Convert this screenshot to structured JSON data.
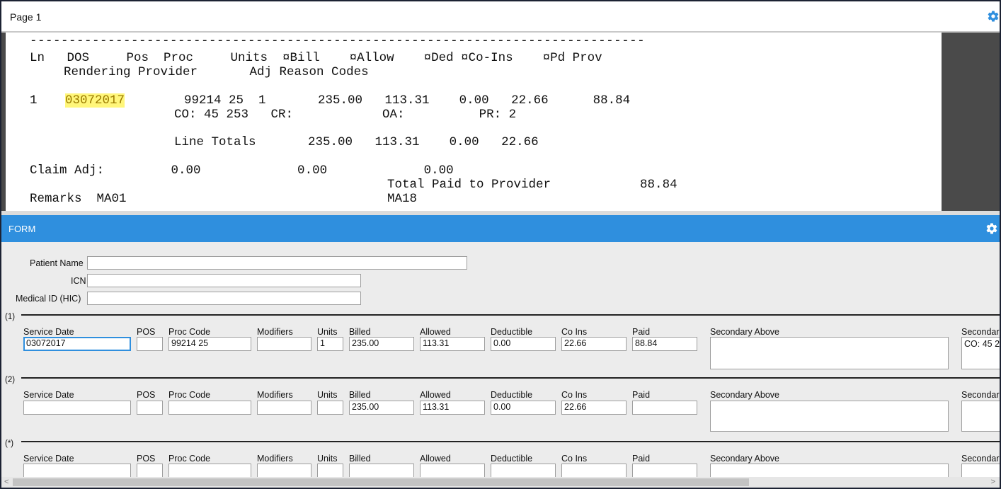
{
  "page_panel": {
    "title": "Page 1",
    "settings_icon": "gear-icon"
  },
  "document": {
    "line_dashes": "-------------------------------------------------------------------------------",
    "header1": "Ln   DOS     Pos  Proc     Units  ¤Bill    ¤Allow    ¤Ded ¤Co-Ins    ¤Pd Prov",
    "header2": "Rendering Provider       Adj Reason Codes",
    "row_ln": "1",
    "row_dos": "03072017",
    "row_rest": "99214 25  1       235.00   113.31    0.00   22.66      88.84",
    "codes": "CO: 45 253   CR:            OA:          PR: 2",
    "line_totals": "Line Totals       235.00   113.31    0.00   22.66",
    "claim_adj": "Claim Adj:         0.00             0.00             0.00",
    "total_paid": "Total Paid to Provider            88.84",
    "remarks": "Remarks  MA01",
    "ma18": "MA18"
  },
  "form_panel": {
    "title": "FORM",
    "settings_icon": "gear-icon"
  },
  "patient": {
    "name_label": "Patient Name",
    "name_value": "",
    "icn_label": "ICN",
    "icn_value": "",
    "medid_label": "Medical ID (HIC)",
    "medid_value": ""
  },
  "columns": {
    "service_date": "Service Date",
    "pos": "POS",
    "proc_code": "Proc Code",
    "modifiers": "Modifiers",
    "units": "Units",
    "billed": "Billed",
    "allowed": "Allowed",
    "deductible": "Deductible",
    "co_ins": "Co Ins",
    "paid": "Paid",
    "secondary_above": "Secondary Above",
    "secondary_below": "Secondar"
  },
  "lines": [
    {
      "marker": "(1)",
      "service_date": "03072017",
      "pos": "",
      "proc_code": "99214 25",
      "modifiers": "",
      "units": "1",
      "billed": "235.00",
      "allowed": "113.31",
      "deductible": "0.00",
      "co_ins": "22.66",
      "paid": "88.84",
      "secondary_above": "",
      "secondary_below": "CO: 45 2"
    },
    {
      "marker": "(2)",
      "service_date": "",
      "pos": "",
      "proc_code": "",
      "modifiers": "",
      "units": "",
      "billed": "235.00",
      "allowed": "113.31",
      "deductible": "0.00",
      "co_ins": "22.66",
      "paid": "",
      "secondary_above": "",
      "secondary_below": ""
    },
    {
      "marker": "(*)",
      "service_date": "",
      "pos": "",
      "proc_code": "",
      "modifiers": "",
      "units": "",
      "billed": "",
      "allowed": "",
      "deductible": "",
      "co_ins": "",
      "paid": "",
      "secondary_above": "",
      "secondary_below": ""
    }
  ],
  "scrollbar": {
    "left_arrow": "<",
    "right_arrow": ">"
  }
}
